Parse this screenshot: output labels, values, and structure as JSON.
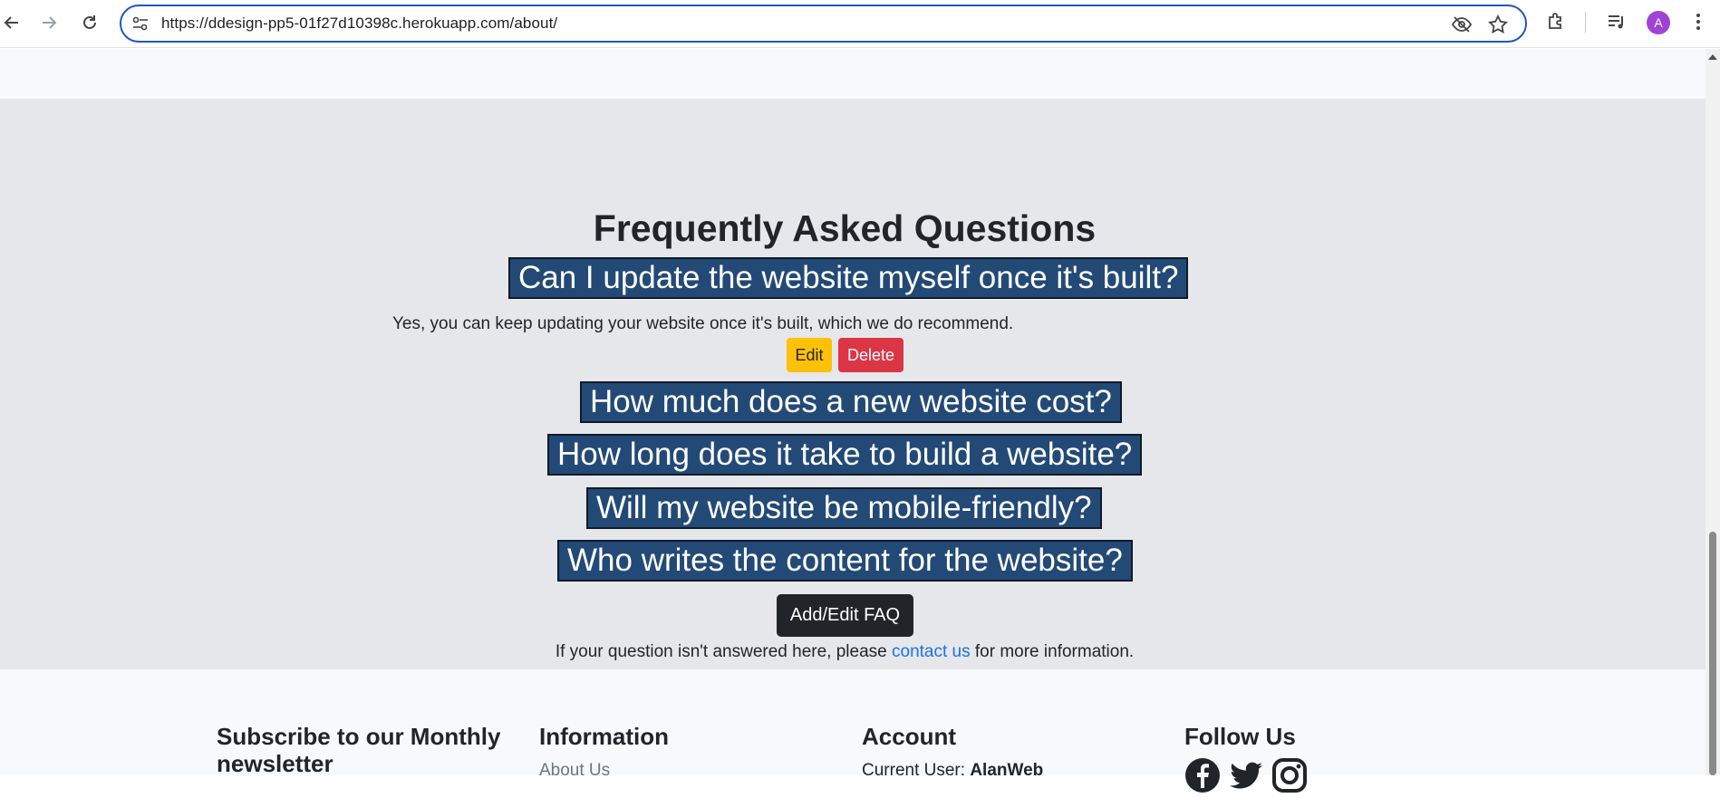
{
  "browser": {
    "url": "https://ddesign-pp5-01f27d10398c.herokuapp.com/about/",
    "avatar_letter": "A"
  },
  "faq": {
    "title": "Frequently Asked Questions",
    "questions": [
      "Can I update the website myself once it's built?",
      "How much does a new website cost?",
      "How long does it take to build a website?",
      "Will my website be mobile-friendly?",
      "Who writes the content for the website?"
    ],
    "answer": "Yes, you can keep updating your website once it's built, which we do recommend.",
    "edit_label": "Edit",
    "delete_label": "Delete",
    "add_edit_label": "Add/Edit FAQ",
    "contact_prefix": "If your question isn't answered here, please ",
    "contact_link": "contact us",
    "contact_suffix": " for more information."
  },
  "footer": {
    "subscribe_heading": "Subscribe to our Monthly newsletter",
    "information_heading": "Information",
    "information_link": "About Us",
    "account_heading": "Account",
    "current_user_label": "Current User: ",
    "current_user_name": "AlanWeb",
    "follow_heading": "Follow Us",
    "social_icons": [
      "facebook-icon",
      "twitter-icon",
      "instagram-icon"
    ]
  },
  "colors": {
    "question_bg": "#234a76",
    "edit_bg": "#ffc107",
    "delete_bg": "#dc3545",
    "add_edit_bg": "#212529",
    "link": "#1a73e8",
    "section_bg": "#e6e7ea"
  }
}
